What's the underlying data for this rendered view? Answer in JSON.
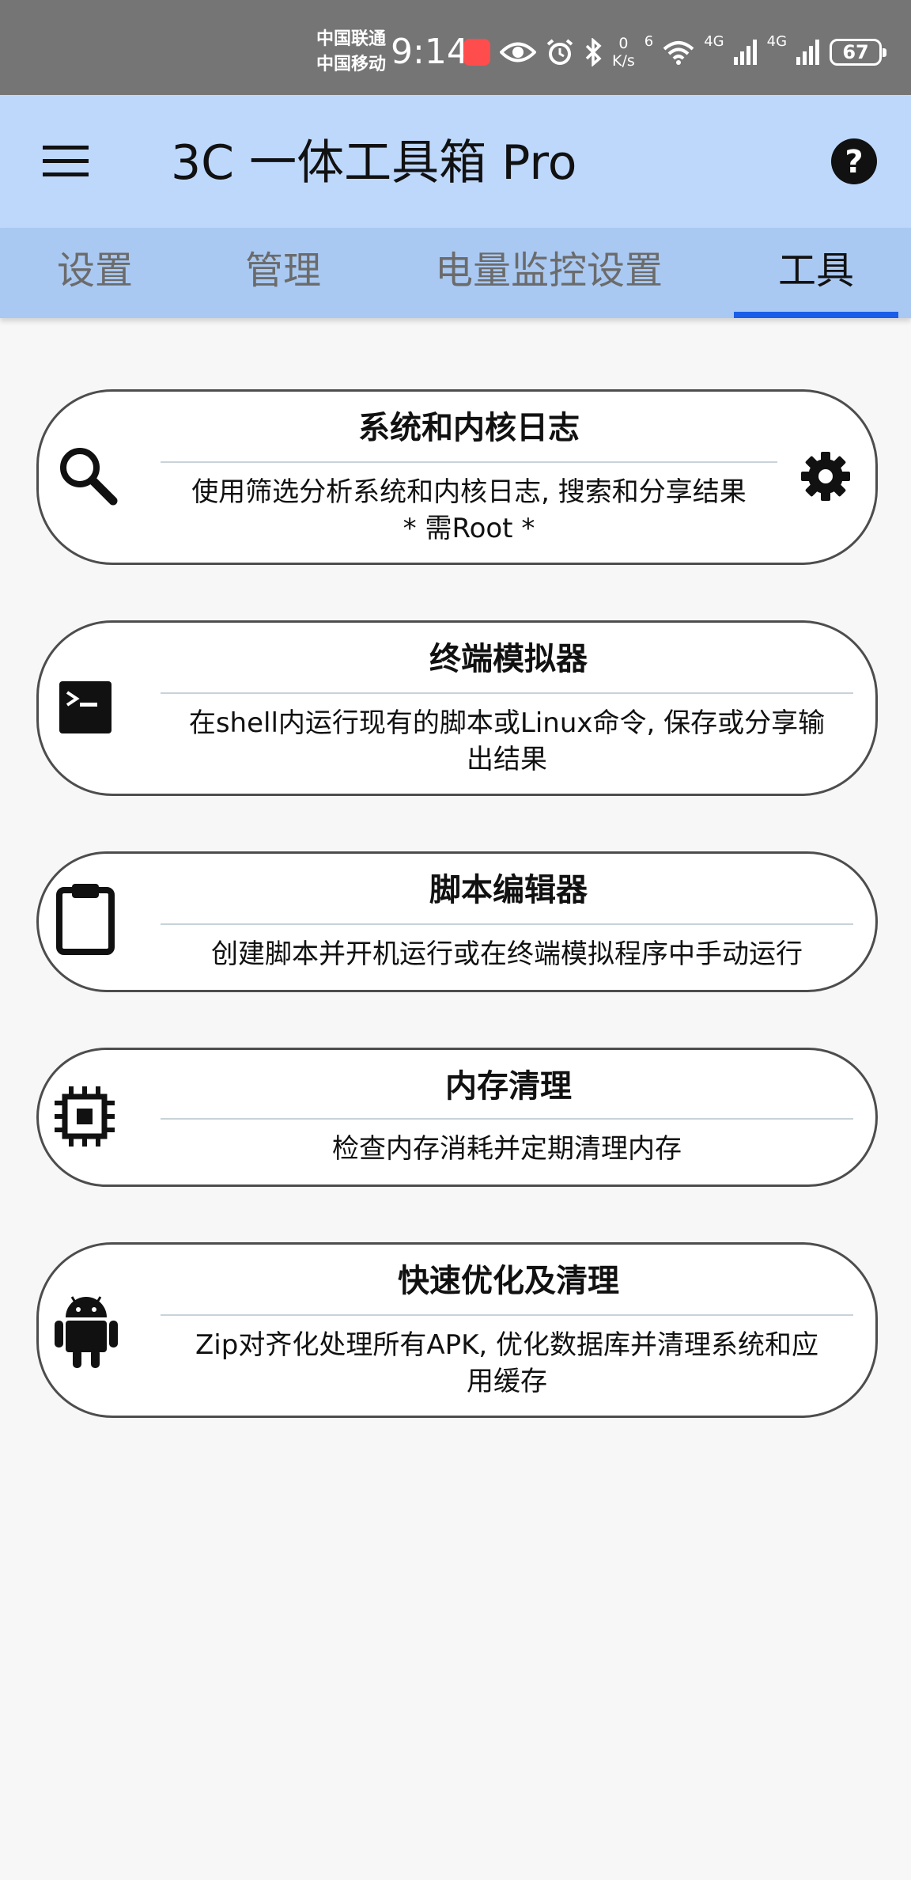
{
  "status_bar": {
    "carrier_1": "中国联通",
    "carrier_2": "中国移动",
    "time": "9:14",
    "net_speed_value": "0",
    "net_speed_unit": "K/s",
    "wifi_label": "6",
    "signal_1_label": "4G",
    "signal_2_label": "4G",
    "battery": "67"
  },
  "app_bar": {
    "title": "3C 一体工具箱 Pro"
  },
  "tabs": [
    {
      "label": "设置"
    },
    {
      "label": "管理"
    },
    {
      "label": "电量监控设置"
    },
    {
      "label": "工具"
    }
  ],
  "cards": [
    {
      "title": "系统和内核日志",
      "desc_1": "使用筛选分析系统和内核日志, 搜索和分享结果",
      "desc_2": "* 需Root *",
      "icon": "search-icon"
    },
    {
      "title": "终端模拟器",
      "desc_1": "在shell内运行现有的脚本或Linux命令, 保存或分享输",
      "desc_2": "出结果",
      "icon": "terminal-icon"
    },
    {
      "title": "脚本编辑器",
      "desc_1": "创建脚本并开机运行或在终端模拟程序中手动运行",
      "icon": "clipboard-icon"
    },
    {
      "title": "内存清理",
      "desc_1": "检查内存消耗并定期清理内存",
      "icon": "memory-chip-icon"
    },
    {
      "title": "快速优化及清理",
      "desc_1": "Zip对齐化处理所有APK, 优化数据库并清理系统和应",
      "desc_2": "用缓存",
      "icon": "android-icon"
    }
  ],
  "colors": {
    "app_bar": "#bed8fc",
    "tab_bar": "#aac9f2",
    "tab_indicator": "#1a5ee8",
    "status_bar": "#757575"
  }
}
